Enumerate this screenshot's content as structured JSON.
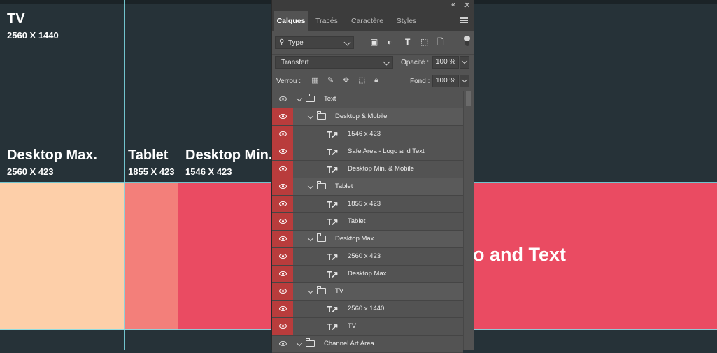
{
  "canvas": {
    "zones": [
      {
        "id": "tv",
        "title": "TV",
        "size": "2560 X 1440"
      },
      {
        "id": "desktop-max",
        "title": "Desktop Max.",
        "size": "2560 X 423"
      },
      {
        "id": "tablet",
        "title": "Tablet",
        "size": "1855 X 423"
      },
      {
        "id": "desktop-min",
        "title": "Desktop Min.",
        "size": "1546 X 423"
      }
    ],
    "safe_area_text": "o and Text",
    "colors": {
      "background": "#263238",
      "desktop_max": "#fdcfa9",
      "tablet": "#f37f7a",
      "desktop_min": "#ea4b62",
      "guides": "#7fdde8"
    }
  },
  "panel": {
    "tabs": [
      "Calques",
      "Tracés",
      "Caractère",
      "Styles"
    ],
    "active_tab": "Calques",
    "filter": {
      "value": "Type"
    },
    "filter_icons": [
      "image-filter-icon",
      "adjustment-filter-icon",
      "type-filter-icon",
      "shape-filter-icon",
      "smart-object-filter-icon"
    ],
    "blend_mode": "Transfert",
    "opacity_label": "Opacité :",
    "opacity_value": "100 %",
    "lock_label": "Verrou :",
    "fill_label": "Fond :",
    "fill_value": "100 %",
    "layers": [
      {
        "name": "Text",
        "kind": "group",
        "indent": 0,
        "eye": "plain"
      },
      {
        "name": "Desktop & Mobile",
        "kind": "group",
        "indent": 1,
        "eye": "red"
      },
      {
        "name": "1546 x 423",
        "kind": "text",
        "indent": 2,
        "eye": "red"
      },
      {
        "name": "Safe Area - Logo and Text",
        "kind": "text",
        "indent": 2,
        "eye": "red"
      },
      {
        "name": "Desktop Min. & Mobile",
        "kind": "text",
        "indent": 2,
        "eye": "red"
      },
      {
        "name": "Tablet",
        "kind": "group",
        "indent": 1,
        "eye": "red"
      },
      {
        "name": "1855 x 423",
        "kind": "text",
        "indent": 2,
        "eye": "red"
      },
      {
        "name": "Tablet",
        "kind": "text",
        "indent": 2,
        "eye": "red"
      },
      {
        "name": "Desktop Max",
        "kind": "group",
        "indent": 1,
        "eye": "red"
      },
      {
        "name": "2560 x 423",
        "kind": "text",
        "indent": 2,
        "eye": "red"
      },
      {
        "name": "Desktop Max.",
        "kind": "text",
        "indent": 2,
        "eye": "red"
      },
      {
        "name": "TV",
        "kind": "group",
        "indent": 1,
        "eye": "red"
      },
      {
        "name": "2560 x 1440",
        "kind": "text",
        "indent": 2,
        "eye": "red"
      },
      {
        "name": "TV",
        "kind": "text",
        "indent": 2,
        "eye": "red"
      },
      {
        "name": "Channel Art Area",
        "kind": "group",
        "indent": 0,
        "eye": "plain"
      }
    ]
  }
}
